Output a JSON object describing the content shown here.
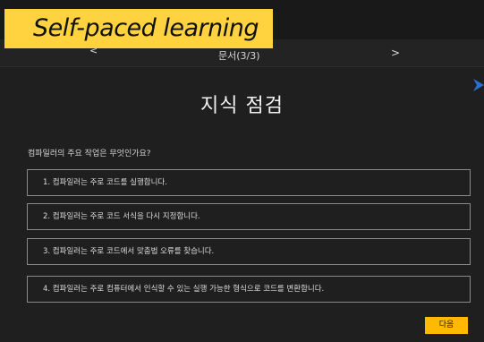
{
  "badge": {
    "text": "Self-paced learning"
  },
  "nav": {
    "prev": "<",
    "progress": "문서(3/3)",
    "next": ">"
  },
  "quiz": {
    "title": "지식 점검",
    "question": "컴파일러의 주요 작업은 무엇인가요?",
    "options": [
      {
        "label": "1.  컴파일러는 주로 코드를 실행합니다."
      },
      {
        "label": "2.  컴파일러는 주로 코드 서식을 다시 지정합니다."
      },
      {
        "label": "3.  컴파일러는 주로 코드에서 맞춤법 오류를 찾습니다."
      },
      {
        "label": "4.  컴파일러는 주로 컴퓨터에서 인식할 수 있는 실행 가능한 형식으로 코드를 변환합니다."
      }
    ]
  },
  "actions": {
    "next_label": "다음"
  },
  "icons": {
    "side_mark": "arrow-right-icon"
  },
  "colors": {
    "background": "#1f1f1f",
    "badge": "#ffd23f",
    "accent": "#ffb900",
    "side_mark": "#2a6fd6"
  }
}
